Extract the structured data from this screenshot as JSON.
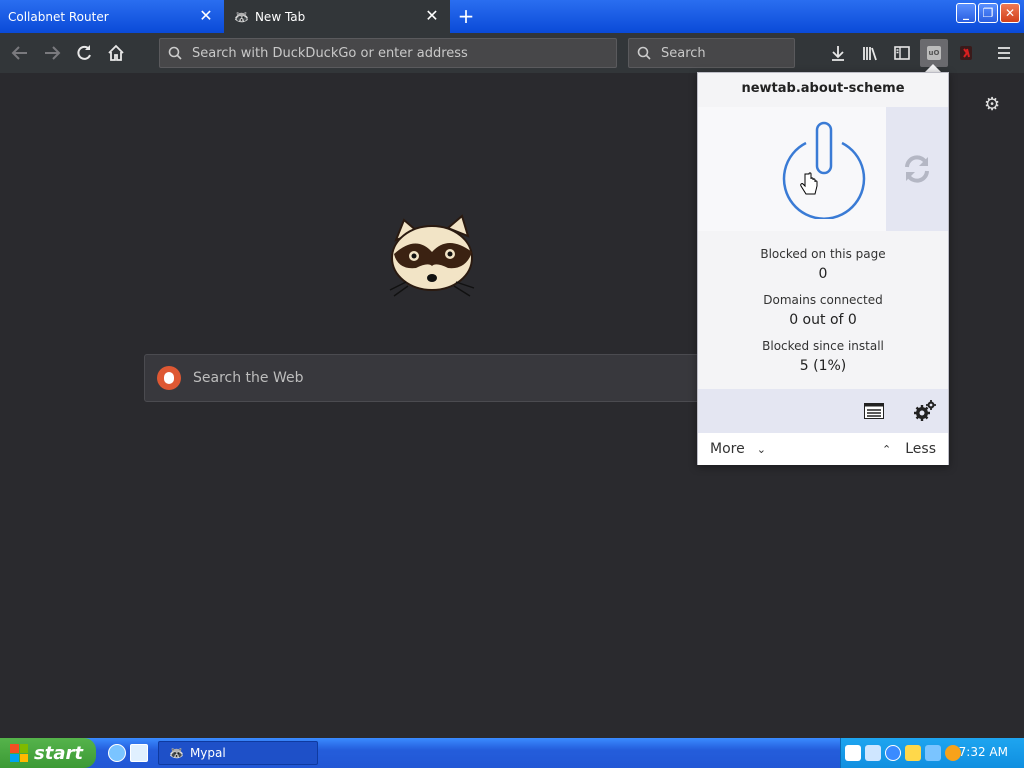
{
  "tabs": [
    {
      "title": "Collabnet Router",
      "active": false
    },
    {
      "title": "New Tab",
      "active": true
    }
  ],
  "icons": {
    "back": "arrow-left-icon",
    "forward": "arrow-right-icon",
    "reload": "reload-icon",
    "home": "home-icon",
    "downloads": "download-icon",
    "library": "library-icon",
    "sidebar": "sidebar-icon",
    "ublock": "ublock-icon",
    "menu": "hamburger-icon"
  },
  "toolbar": {
    "url_placeholder": "Search with DuckDuckGo or enter address",
    "search_placeholder": "Search"
  },
  "page": {
    "search_placeholder": "Search the Web"
  },
  "popup": {
    "hostname": "newtab.about-scheme",
    "stats": [
      {
        "label": "Blocked on this page",
        "value": "0"
      },
      {
        "label": "Domains connected",
        "value": "0 out of 0"
      },
      {
        "label": "Blocked since install",
        "value": "5 (1%)"
      }
    ],
    "more_label": "More",
    "less_label": "Less"
  },
  "taskbar": {
    "start_label": "start",
    "task_label": "Mypal",
    "clock": "7:32 AM"
  },
  "colors": {
    "page_bg": "#2a2a2e",
    "toolbar_bg": "#323639",
    "popup_accent": "#3a7bd5",
    "taskbar_blue": "#245ddb",
    "start_green": "#3c9a35"
  }
}
